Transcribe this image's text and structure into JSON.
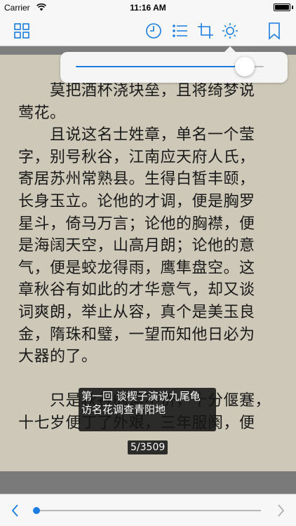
{
  "status_bar": {
    "carrier": "Carrier",
    "time": "11:16 AM"
  },
  "toolbar": {
    "icons": [
      "grid-icon",
      "clock-icon",
      "list-icon",
      "crop-icon",
      "brightness-icon",
      "bookmark-icon"
    ],
    "accent_color": "#1a7ce0"
  },
  "brightness": {
    "level": 0.9
  },
  "page_text": {
    "lines": [
      "　　莫把酒杯浇块垒，且将绮梦说",
      "莺花。",
      "　　且说这名士姓章，单名一个莹",
      "字，别号秋谷，江南应天府人氏，",
      "寄居苏州常熟县。生得白皙丰颐，",
      "长身玉立。论他的才调，便是胸罗",
      "星斗，倚马万言；论他的胸襟，便",
      "是海阔天空，山高月朗；论他的意",
      "气，便是蛟龙得雨，鹰隼盘空。这",
      "章秋谷有如此的才华意气，却又谈",
      "词爽朗，举止从容，真个是美玉良",
      "金，隋珠和璧，一望而知他日必为",
      "大器的了。",
      "",
      "　　只是秋谷的运不济，十分偃蹇，",
      "十七岁便丁了外艰，三年服阕，便"
    ]
  },
  "chapter_overlay": {
    "line1": "第一回 谈楔子演说九尾龟",
    "line2": "访名花调查青阳地"
  },
  "page_badge": "5/3509",
  "progress": {
    "current_page": 5,
    "total_pages": 3509
  }
}
